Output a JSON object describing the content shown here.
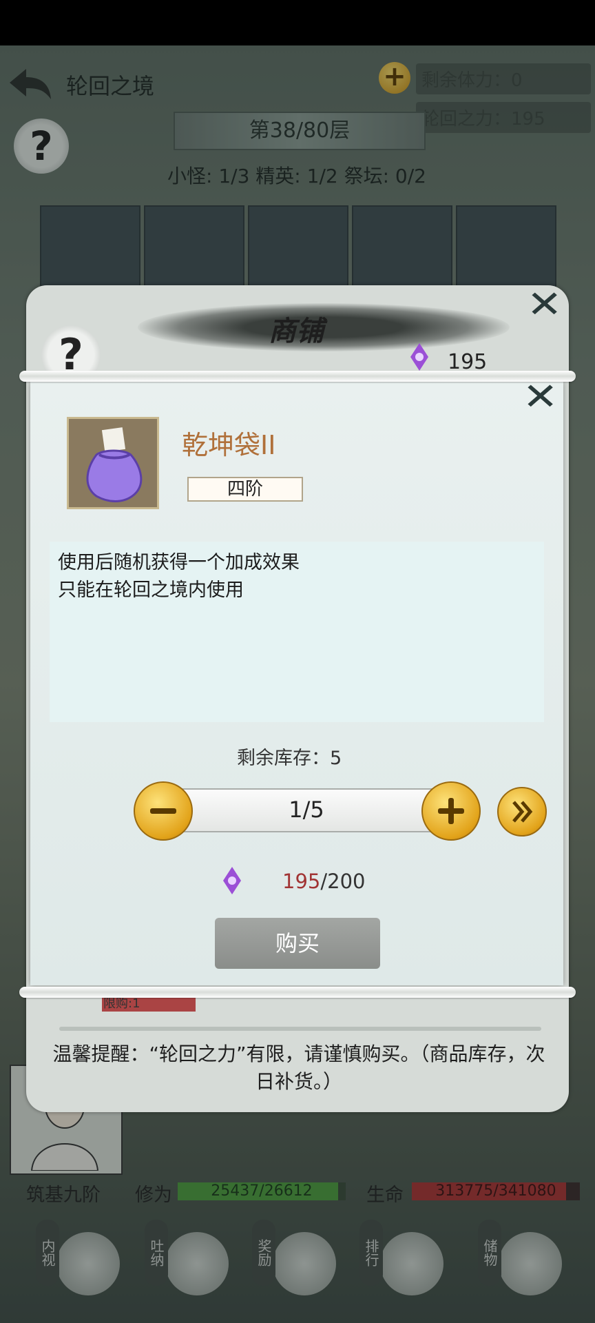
{
  "header": {
    "title": "轮回之境",
    "stamina": "剩余体力：0",
    "reincarnation_power": "轮回之力：195",
    "floor": "第38/80层",
    "counts": "小怪: 1/3 精英: 1/2 祭坛: 0/2"
  },
  "shop": {
    "title": "商铺",
    "currency_amount": "195",
    "tip": "温馨提醒：“轮回之力”有限，请谨慎购买。（商品库存，次日补货。）",
    "limit_tag": "限购:1"
  },
  "item": {
    "name": "乾坤袋II",
    "tier": "四阶",
    "description": [
      "使用后随机获得一个加成效果",
      "只能在轮回之境内使用"
    ],
    "stock": "剩余库存：5",
    "quantity": "1/5",
    "price_current": "195",
    "price_total": "/200",
    "buy_label": "购买"
  },
  "player": {
    "realm": "筑基九阶",
    "cultivation_label": "修为",
    "cultivation_value": "25437/26612",
    "cultivation_progress": 0.956,
    "life_label": "生命",
    "life_value": "313775/341080",
    "life_progress": 0.92
  },
  "nav": [
    {
      "label": "内视",
      "icon": "eye-icon"
    },
    {
      "label": "吐纳",
      "icon": "meditation-icon"
    },
    {
      "label": "奖励",
      "icon": "gift-icon"
    },
    {
      "label": "排行",
      "icon": "ranking-icon"
    },
    {
      "label": "储物",
      "icon": "bag-icon"
    }
  ],
  "colors": {
    "item_name": "#b0703a",
    "price_current": "#a13434",
    "gold_button": "#e2a31a",
    "gem": "#9b4fd6"
  }
}
